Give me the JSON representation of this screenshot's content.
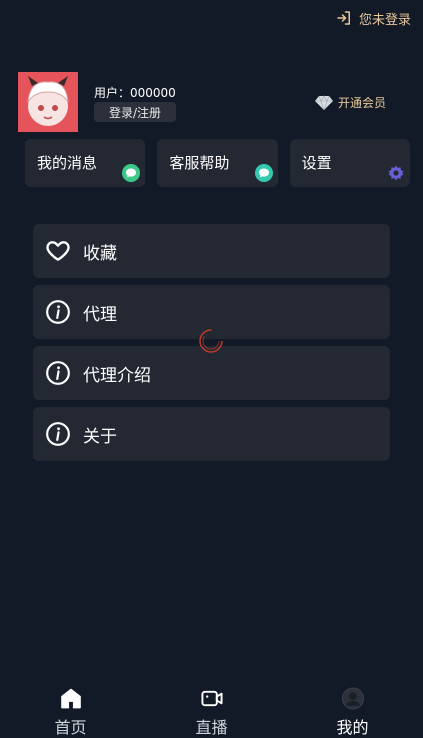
{
  "header": {
    "login_label": "您未登录"
  },
  "profile": {
    "user_id": "用户：000000",
    "login_button": "登录/注册",
    "vip_label": "开通会员"
  },
  "quick_cards": [
    {
      "label": "我的消息",
      "icon": "chat-bubble-icon"
    },
    {
      "label": "客服帮助",
      "icon": "chat-bubble-icon"
    },
    {
      "label": "设置",
      "icon": "gear-icon"
    }
  ],
  "menu": [
    {
      "label": "收藏",
      "icon": "heart-icon"
    },
    {
      "label": "代理",
      "icon": "info-icon"
    },
    {
      "label": "代理介绍",
      "icon": "info-icon"
    },
    {
      "label": "关于",
      "icon": "info-icon"
    }
  ],
  "tabbar": [
    {
      "label": "首页",
      "icon": "home-icon"
    },
    {
      "label": "直播",
      "icon": "video-camera-icon"
    },
    {
      "label": "我的",
      "icon": "user-avatar-icon",
      "active": true
    }
  ],
  "colors": {
    "background": "#131a27",
    "card": "#232833",
    "gold": "#e6c79a",
    "avatar_bg": "#e4545a"
  }
}
